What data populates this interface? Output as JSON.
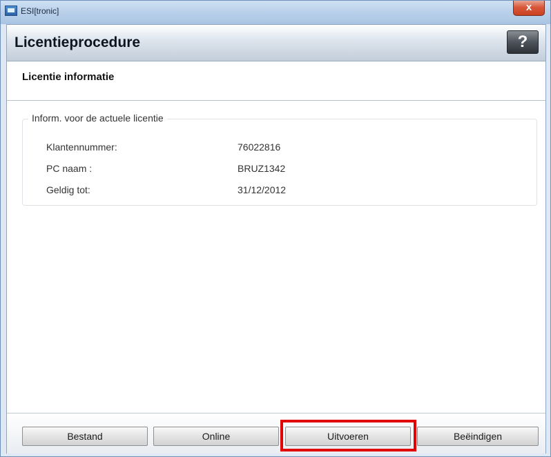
{
  "window": {
    "title": "ESI[tronic]",
    "close_label": "x"
  },
  "header": {
    "title": "Licentieprocedure",
    "help_label": "?"
  },
  "subheader": {
    "title": "Licentie informatie"
  },
  "license_group": {
    "legend": "Inform. voor de actuele licentie",
    "rows": [
      {
        "label": "Klantennummer:",
        "value": "76022816"
      },
      {
        "label": "PC naam :",
        "value": "BRUZ1342"
      },
      {
        "label": "Geldig tot:",
        "value": "31/12/2012"
      }
    ]
  },
  "footer": {
    "buttons": [
      {
        "label": "Bestand"
      },
      {
        "label": "Online"
      },
      {
        "label": "Uitvoeren",
        "highlighted": true,
        "highlight_color": "#e00000"
      },
      {
        "label": "Beëindigen"
      }
    ]
  },
  "colors": {
    "highlight": "#e00000",
    "titlebar": "#b9d0ea",
    "help_button": "#4d535b"
  }
}
